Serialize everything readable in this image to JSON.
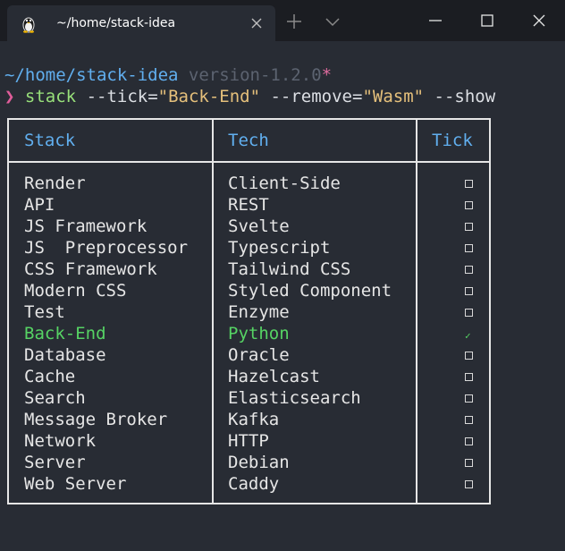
{
  "tab": {
    "title": "~/home/stack-idea",
    "icon": "tux-icon",
    "close_icon": "close-icon"
  },
  "titlebar": {
    "new_tab_icon": "plus-icon",
    "dropdown_icon": "chevron-down-icon",
    "minimize_icon": "minimize-icon",
    "maximize_icon": "maximize-icon",
    "close_icon": "close-icon"
  },
  "prompt": {
    "path": "~/home/stack-idea",
    "version": "version-1.2.0",
    "dirty_marker": "*",
    "symbol": "❯",
    "command": "stack",
    "args": [
      {
        "flag": "--tick=",
        "value": "\"Back-End\""
      },
      {
        "flag": "--remove=",
        "value": "\"Wasm\""
      },
      {
        "flag": "--show",
        "value": ""
      }
    ]
  },
  "table": {
    "headers": [
      "Stack",
      "Tech",
      "Tick"
    ],
    "rows": [
      {
        "stack": "Render",
        "tech": "Client-Side",
        "ticked": false
      },
      {
        "stack": "API",
        "tech": "REST",
        "ticked": false
      },
      {
        "stack": "JS Framework",
        "tech": "Svelte",
        "ticked": false
      },
      {
        "stack": "JS  Preprocessor",
        "tech": "Typescript",
        "ticked": false
      },
      {
        "stack": "CSS Framework",
        "tech": "Tailwind CSS",
        "ticked": false
      },
      {
        "stack": "Modern CSS",
        "tech": "Styled Component",
        "ticked": false
      },
      {
        "stack": "Test",
        "tech": "Enzyme",
        "ticked": false
      },
      {
        "stack": "Back-End",
        "tech": "Python",
        "ticked": true
      },
      {
        "stack": "Database",
        "tech": "Oracle",
        "ticked": false
      },
      {
        "stack": "Cache",
        "tech": "Hazelcast",
        "ticked": false
      },
      {
        "stack": "Search",
        "tech": "Elasticsearch",
        "ticked": false
      },
      {
        "stack": "Message Broker",
        "tech": "Kafka",
        "ticked": false
      },
      {
        "stack": "Network",
        "tech": "HTTP",
        "ticked": false
      },
      {
        "stack": "Server",
        "tech": "Debian",
        "ticked": false
      },
      {
        "stack": "Web Server",
        "tech": "Caddy",
        "ticked": false
      }
    ]
  },
  "colors": {
    "background": "#282c34",
    "titlebar": "#1b1d22",
    "path": "#61afef",
    "highlight": "#56d364",
    "prompt_symbol": "#e05d9a",
    "string": "#e5c07b"
  }
}
